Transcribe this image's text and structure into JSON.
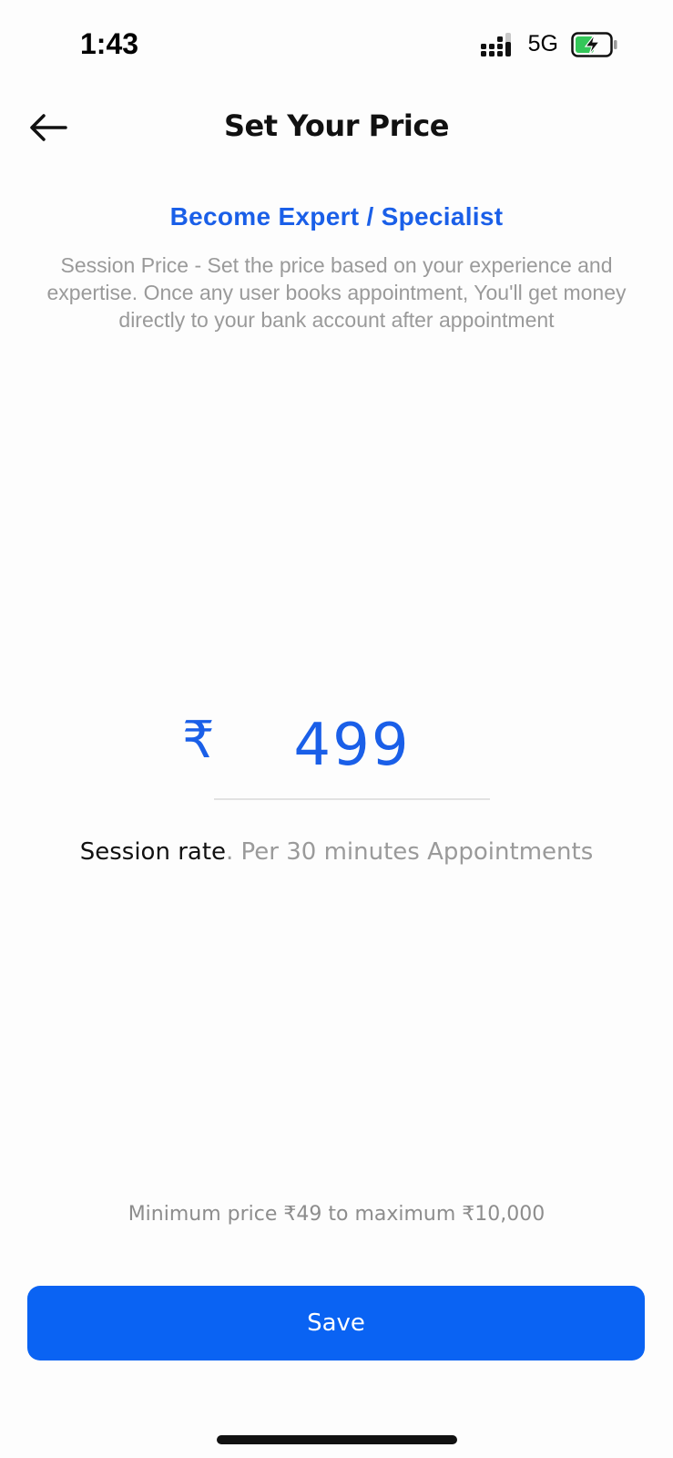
{
  "status_bar": {
    "time": "1:43",
    "network": "5G",
    "signal_icon": "signal-bars-icon",
    "battery_icon": "battery-charging-icon",
    "battery_color": "#34c759"
  },
  "header": {
    "title": "Set Your Price",
    "back_icon": "arrow-left-icon"
  },
  "intro": {
    "heading": "Become Expert / Specialist",
    "description": "Session Price - Set the price based on your experience and expertise. Once any user books appointment, You'll get money directly to your bank account after appointment"
  },
  "price": {
    "currency_symbol": "₹",
    "value": "499"
  },
  "session_rate": {
    "label": "Session rate",
    "detail": ". Per 30 minutes Appointments"
  },
  "price_range": "Minimum price ₹49 to maximum ₹10,000",
  "save_label": "Save",
  "colors": {
    "accent": "#1a5fe8",
    "button": "#0a63f3",
    "muted_text": "#9a9a9a"
  }
}
